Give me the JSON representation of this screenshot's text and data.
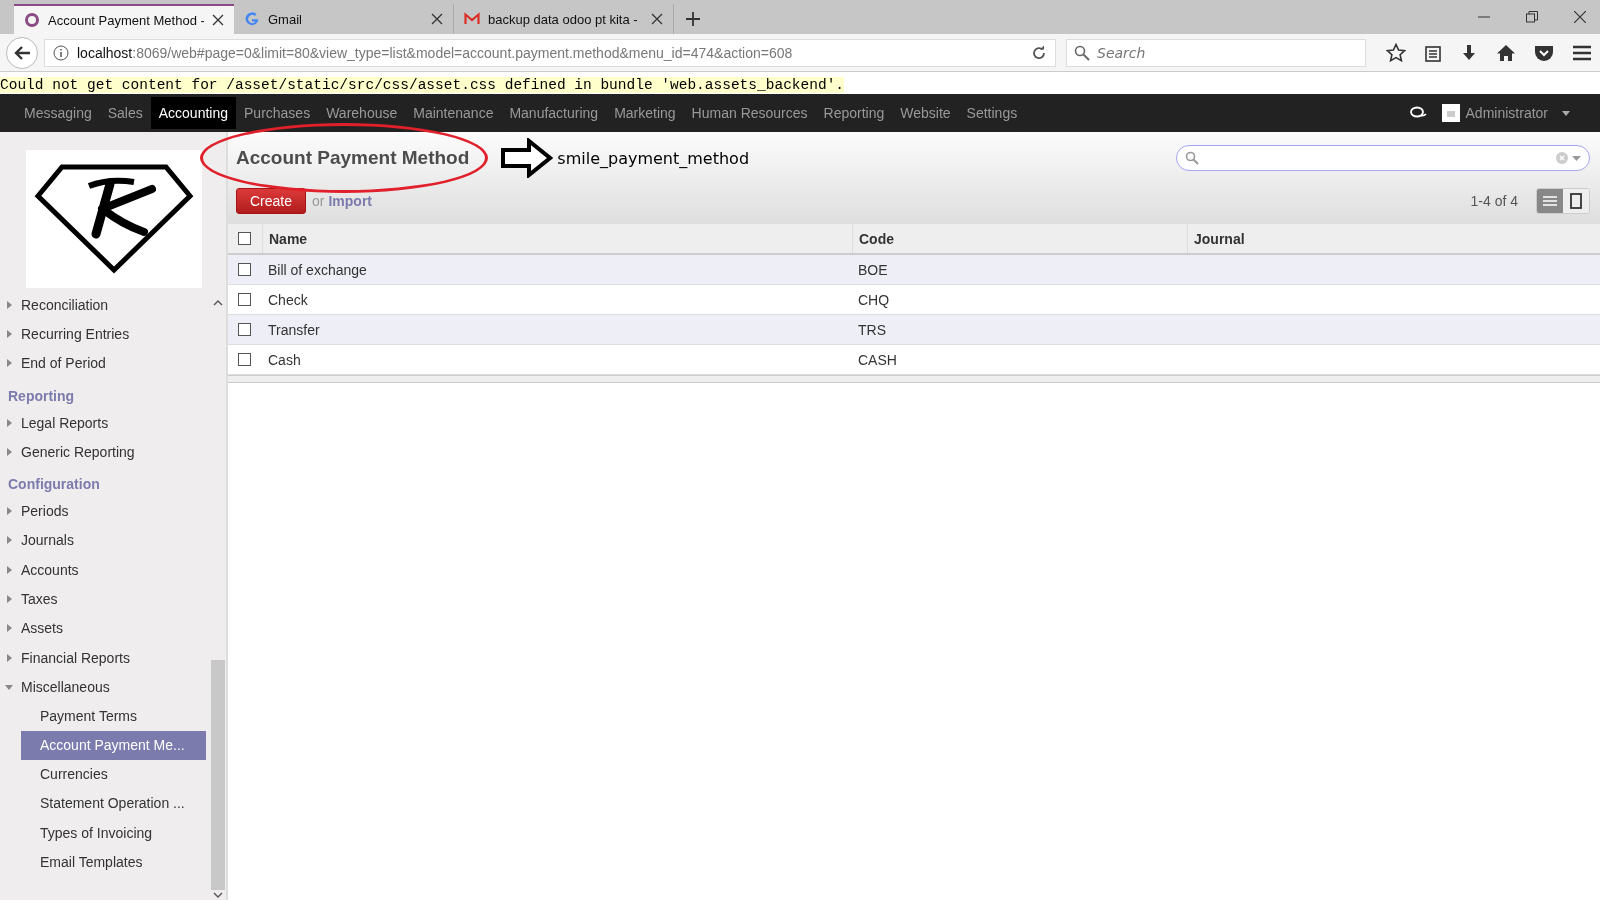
{
  "browser": {
    "tabs": [
      {
        "title": "Account Payment Method -",
        "selected": true,
        "kind": "odoo"
      },
      {
        "title": "Gmail",
        "selected": false,
        "kind": "google"
      },
      {
        "title": "backup data odoo pt kita -",
        "selected": false,
        "kind": "gmail"
      }
    ],
    "address": {
      "host": "localhost",
      "rest": ":8069/web#page=0&limit=80&view_type=list&model=account.payment.method&menu_id=474&action=608"
    },
    "search": {
      "placeholder": "Search"
    }
  },
  "error_message": "Could not get content for /asset/static/src/css/asset.css defined in bundle 'web.assets_backend'.",
  "top_menu": [
    {
      "label": "Messaging",
      "selected": false
    },
    {
      "label": "Sales",
      "selected": false
    },
    {
      "label": "Accounting",
      "selected": true
    },
    {
      "label": "Purchases",
      "selected": false
    },
    {
      "label": "Warehouse",
      "selected": false
    },
    {
      "label": "Maintenance",
      "selected": false
    },
    {
      "label": "Manufacturing",
      "selected": false
    },
    {
      "label": "Marketing",
      "selected": false
    },
    {
      "label": "Human Resources",
      "selected": false
    },
    {
      "label": "Reporting",
      "selected": false
    },
    {
      "label": "Website",
      "selected": false
    },
    {
      "label": "Settings",
      "selected": false
    }
  ],
  "user": {
    "name": "Administrator"
  },
  "sidebar": [
    {
      "kind": "item",
      "label": "Reconciliation",
      "expanded": false
    },
    {
      "kind": "item",
      "label": "Recurring Entries",
      "expanded": false
    },
    {
      "kind": "item",
      "label": "End of Period",
      "expanded": false
    },
    {
      "kind": "heading",
      "label": "Reporting"
    },
    {
      "kind": "item",
      "label": "Legal Reports",
      "expanded": false
    },
    {
      "kind": "item",
      "label": "Generic Reporting",
      "expanded": false
    },
    {
      "kind": "heading",
      "label": "Configuration"
    },
    {
      "kind": "item",
      "label": "Periods",
      "expanded": false
    },
    {
      "kind": "item",
      "label": "Journals",
      "expanded": false
    },
    {
      "kind": "item",
      "label": "Accounts",
      "expanded": false
    },
    {
      "kind": "item",
      "label": "Taxes",
      "expanded": false
    },
    {
      "kind": "item",
      "label": "Assets",
      "expanded": false
    },
    {
      "kind": "item",
      "label": "Financial Reports",
      "expanded": false
    },
    {
      "kind": "item",
      "label": "Miscellaneous",
      "expanded": true,
      "children": [
        {
          "label": "Payment Terms",
          "selected": false
        },
        {
          "label": "Account Payment Me...",
          "selected": true
        },
        {
          "label": "Currencies",
          "selected": false
        },
        {
          "label": "Statement Operation ...",
          "selected": false
        },
        {
          "label": "Types of Invoicing",
          "selected": false
        },
        {
          "label": "Email Templates",
          "selected": false
        }
      ]
    }
  ],
  "view": {
    "title": "Account Payment Method",
    "annotation": "smile_payment_method",
    "create": "Create",
    "or": "or",
    "import": "Import",
    "pager": "1-4 of 4",
    "view_modes": [
      {
        "kind": "list",
        "selected": true
      },
      {
        "kind": "form",
        "selected": false
      }
    ]
  },
  "table": {
    "select_all_checked": false,
    "columns": [
      "Name",
      "Code",
      "Journal"
    ],
    "rows": [
      {
        "checked": false,
        "cells": [
          "Bill of exchange",
          "BOE",
          ""
        ]
      },
      {
        "checked": false,
        "cells": [
          "Check",
          "CHQ",
          ""
        ]
      },
      {
        "checked": false,
        "cells": [
          "Transfer",
          "TRS",
          ""
        ]
      },
      {
        "checked": false,
        "cells": [
          "Cash",
          "CASH",
          ""
        ]
      }
    ]
  }
}
